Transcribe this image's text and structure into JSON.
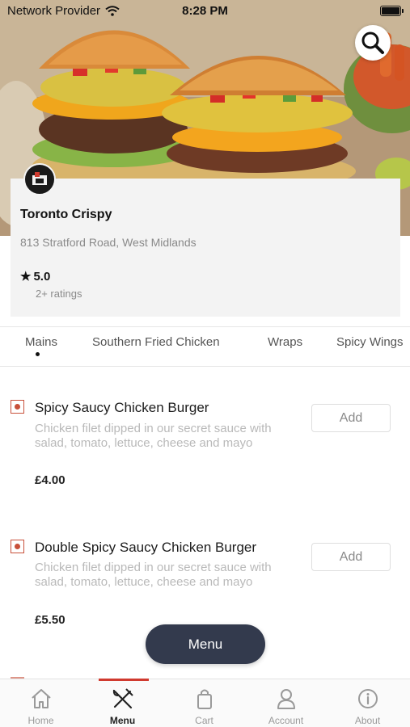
{
  "status_bar": {
    "carrier": "Network Provider",
    "time": "8:28 PM"
  },
  "restaurant": {
    "name": "Toronto Crispy",
    "address": "813 Stratford Road, West Midlands",
    "rating": "5.0",
    "ratings_count": "2+ ratings"
  },
  "categories": {
    "active_index": 0,
    "items": [
      "Mains",
      "Southern Fried Chicken",
      "Wraps",
      "Spicy Wings"
    ]
  },
  "menu_items": [
    {
      "name": "Spicy Saucy Chicken Burger",
      "description": "Chicken filet dipped in our secret sauce with salad, tomato, lettuce, cheese and mayo",
      "price": "£4.00",
      "add_label": "Add"
    },
    {
      "name": "Double Spicy Saucy Chicken Burger",
      "description": "Chicken filet dipped in our secret sauce with salad, tomato, lettuce, cheese and mayo",
      "price": "£5.50",
      "add_label": "Add"
    }
  ],
  "floating_button": {
    "label": "Menu"
  },
  "bottom_nav": {
    "active": "Menu",
    "items": [
      {
        "label": "Home",
        "icon": "home-icon"
      },
      {
        "label": "Menu",
        "icon": "fork-knife-icon"
      },
      {
        "label": "Cart",
        "icon": "shopping-bag-icon"
      },
      {
        "label": "Account",
        "icon": "user-icon"
      },
      {
        "label": "About",
        "icon": "info-icon"
      }
    ]
  },
  "colors": {
    "accent": "#d03a2f",
    "veg_marker": "#c8503a",
    "floating_button_bg": "#333a4d",
    "card_bg": "#f3f3f3"
  }
}
